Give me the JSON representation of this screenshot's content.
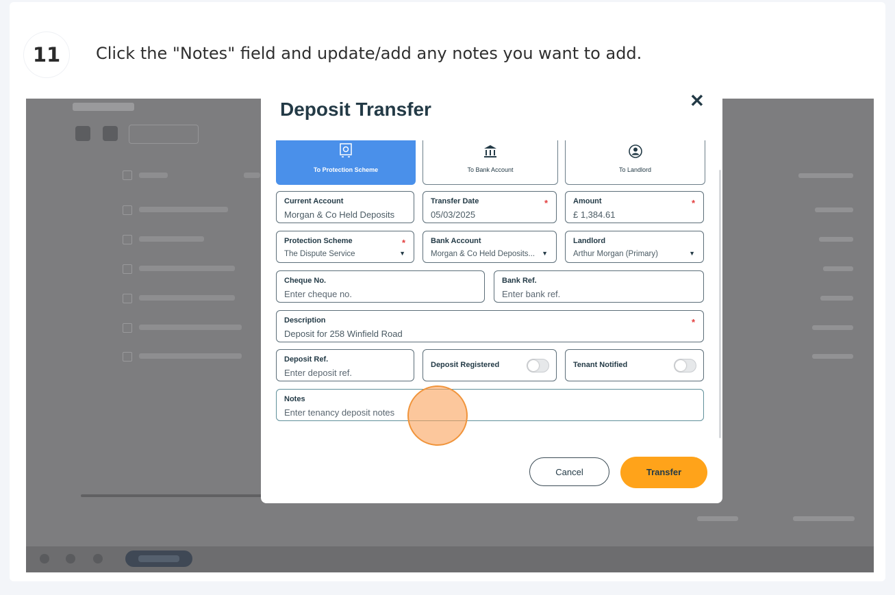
{
  "step": {
    "number": "11",
    "instruction": "Click the \"Notes\" field and update/add any notes you want to add."
  },
  "modal": {
    "title": "Deposit Transfer",
    "close_icon": "close-icon",
    "tabs": [
      {
        "label": "To Protection Scheme",
        "icon": "safe-icon",
        "active": true
      },
      {
        "label": "To Bank Account",
        "icon": "bank-icon",
        "active": false
      },
      {
        "label": "To Landlord",
        "icon": "user-icon",
        "active": false
      }
    ],
    "fields": {
      "current_account": {
        "label": "Current Account",
        "value": "Morgan & Co Held Deposits"
      },
      "transfer_date": {
        "label": "Transfer Date",
        "value": "05/03/2025",
        "required": "*"
      },
      "amount": {
        "label": "Amount",
        "value": "£ 1,384.61",
        "required": "*"
      },
      "protection_scheme": {
        "label": "Protection Scheme",
        "value": "The Dispute Service",
        "required": "*"
      },
      "bank_account": {
        "label": "Bank Account",
        "value": "Morgan & Co Held Deposits..."
      },
      "landlord": {
        "label": "Landlord",
        "value": "Arthur Morgan (Primary)"
      },
      "cheque_no": {
        "label": "Cheque No.",
        "placeholder": "Enter cheque no."
      },
      "bank_ref": {
        "label": "Bank Ref.",
        "placeholder": "Enter bank ref."
      },
      "description": {
        "label": "Description",
        "value": "Deposit for 258 Winfield Road",
        "required": "*"
      },
      "deposit_ref": {
        "label": "Deposit Ref.",
        "placeholder": "Enter deposit ref."
      },
      "deposit_registered": {
        "label": "Deposit Registered",
        "checked": false
      },
      "tenant_notified": {
        "label": "Tenant Notified",
        "checked": false
      },
      "notes": {
        "label": "Notes",
        "placeholder": "Enter tenancy deposit notes"
      }
    },
    "buttons": {
      "cancel": "Cancel",
      "transfer": "Transfer"
    }
  },
  "colors": {
    "accent_blue": "#4a90ea",
    "transfer_orange": "#ffa31a",
    "required_red": "#e23c3c",
    "cursor_highlight": "#f0943b"
  }
}
